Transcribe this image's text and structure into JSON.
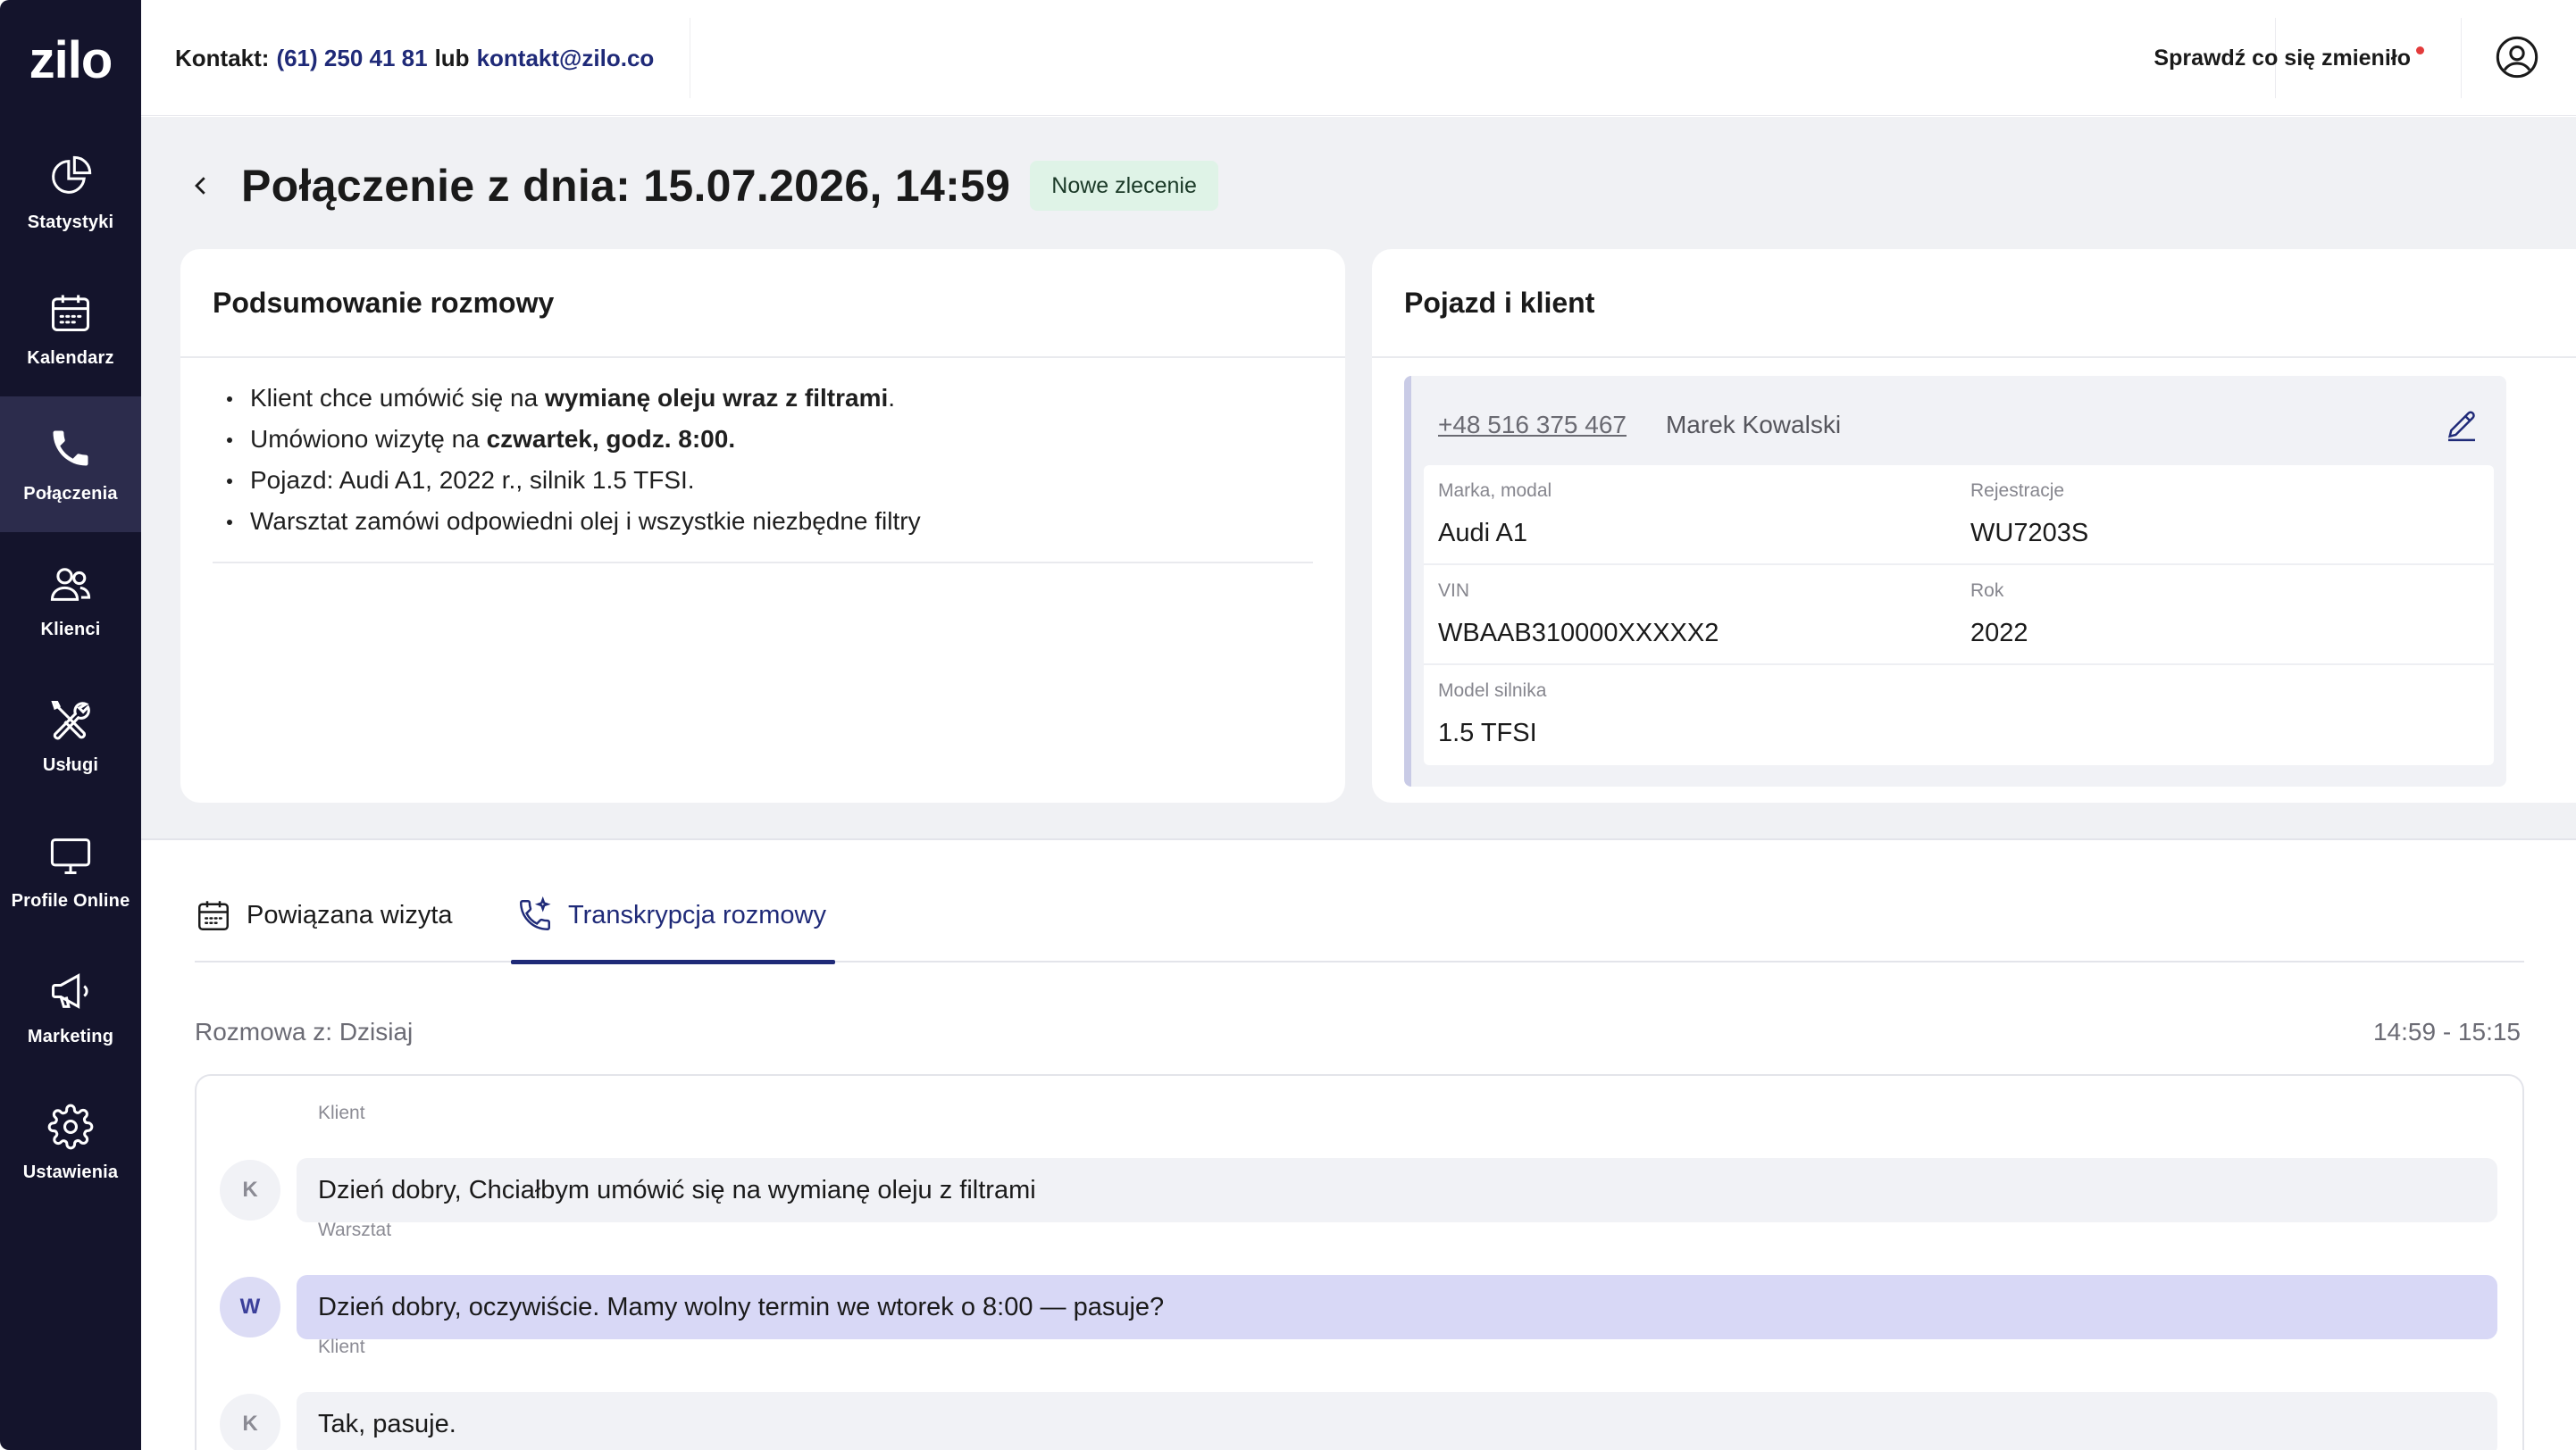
{
  "brand": {
    "logo_text": "zilo"
  },
  "sidebar": {
    "items": [
      {
        "label": "Statystyki",
        "icon": "pie-chart-icon"
      },
      {
        "label": "Kalendarz",
        "icon": "calendar-icon"
      },
      {
        "label": "Połączenia",
        "icon": "phone-icon",
        "active": true
      },
      {
        "label": "Klienci",
        "icon": "users-icon"
      },
      {
        "label": "Usługi",
        "icon": "tools-icon"
      },
      {
        "label": "Profile Online",
        "icon": "monitor-icon"
      },
      {
        "label": "Marketing",
        "icon": "megaphone-icon"
      },
      {
        "label": "Ustawienia",
        "icon": "gear-icon"
      }
    ]
  },
  "topbar": {
    "contact_label": "Kontakt:",
    "phone": "(61) 250 41 81",
    "or": "lub",
    "email": "kontakt@zilo.co",
    "whats_new": "Sprawdź co się zmieniło",
    "user_icon": "user-circle-icon"
  },
  "page": {
    "title": "Połączenie z dnia: 15.07.2026, 14:59",
    "badge": "Nowe zlecenie"
  },
  "summary": {
    "title": "Podsumowanie rozmowy",
    "items": [
      {
        "pre": "Klient chce umówić się na ",
        "bold": "wymianę oleju wraz z filtrami",
        "post": "."
      },
      {
        "pre": "Umówiono wizytę na ",
        "bold": "czwartek, godz. 8:00.",
        "post": ""
      },
      {
        "pre": "Pojazd: Audi A1, 2022 r., silnik 1.5 TFSI.",
        "bold": "",
        "post": ""
      },
      {
        "pre": "Warsztat zamówi odpowiedni olej i wszystkie niezbędne filtry",
        "bold": "",
        "post": ""
      }
    ]
  },
  "vehicle": {
    "title": "Pojazd i klient",
    "phone": "+48 516 375 467",
    "client_name": "Marek Kowalski",
    "fields": {
      "make_label": "Marka, modal",
      "make_value": "Audi A1",
      "reg_label": "Rejestracje",
      "reg_value": "WU7203S",
      "vin_label": "VIN",
      "vin_value": "WBAAB310000XXXXX2",
      "year_label": "Rok",
      "year_value": "2022",
      "engine_label": "Model silnika",
      "engine_value": "1.5 TFSI"
    }
  },
  "tabs": [
    {
      "label": "Powiązana wizyta",
      "icon": "calendar-icon"
    },
    {
      "label": "Transkrypcja rozmowy",
      "icon": "phone-sparkle-icon",
      "active": true
    }
  ],
  "conversation": {
    "label": "Rozmowa z: Dzisiaj",
    "time_range": "14:59 - 15:15",
    "messages": [
      {
        "speaker": "Klient",
        "initial": "K",
        "text": "Dzień dobry, Chciałbym umówić się na wymianę oleju z filtrami"
      },
      {
        "speaker": "Warsztat",
        "initial": "W",
        "text": "Dzień dobry, oczywiście. Mamy wolny termin we wtorek o 8:00 — pasuje?"
      },
      {
        "speaker": "Klient",
        "initial": "K",
        "text": "Tak, pasuje."
      }
    ]
  },
  "colors": {
    "sidebar_bg": "#14142c",
    "accent": "#1f2a78",
    "badge_bg": "#dff3e7",
    "notification_dot": "#e33b3b"
  }
}
